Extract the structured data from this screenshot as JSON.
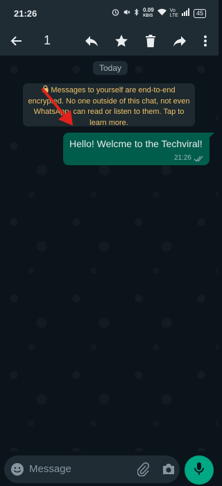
{
  "status_bar": {
    "time": "21:26",
    "network_speed": "0.09",
    "network_unit": "KB/S",
    "battery": "45"
  },
  "toolbar": {
    "selected_count": "1",
    "icons": [
      "back-arrow-icon",
      "reply-icon",
      "star-icon",
      "delete-icon",
      "forward-icon",
      "more-vert-icon"
    ]
  },
  "chat": {
    "date_label": "Today",
    "e2e_notice": "Messages to yourself are end-to-end encrypted. No one outside of this chat, not even WhatsApp, can read or listen to them. Tap to learn more.",
    "messages": [
      {
        "text": "Hello! Welcme to the Techviral!",
        "time": "21:26",
        "status": "read"
      }
    ]
  },
  "input_bar": {
    "placeholder": "Message"
  },
  "colors": {
    "background": "#0b141a",
    "bar": "#1f2c34",
    "outgoing_bubble": "#005c4b",
    "accent": "#00a884",
    "notice_text": "#f0c26a",
    "annotation_arrow": "#e0221b"
  }
}
